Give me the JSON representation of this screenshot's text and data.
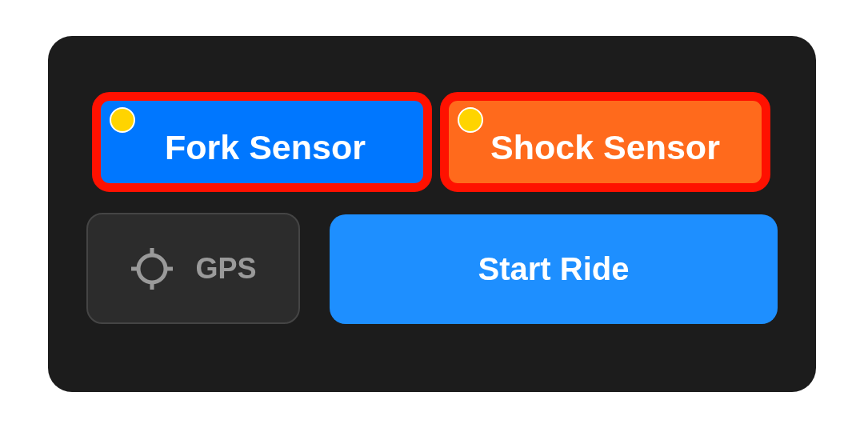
{
  "sensors": [
    {
      "label": "Fork Sensor",
      "selected": true,
      "kind": "fork",
      "color": "#ffd400"
    },
    {
      "label": "Shock Sensor",
      "selected": true,
      "kind": "shock",
      "color": "#ffd400"
    }
  ],
  "gps": {
    "label": "GPS",
    "disabled": true
  },
  "start": {
    "label": "Start Ride"
  }
}
